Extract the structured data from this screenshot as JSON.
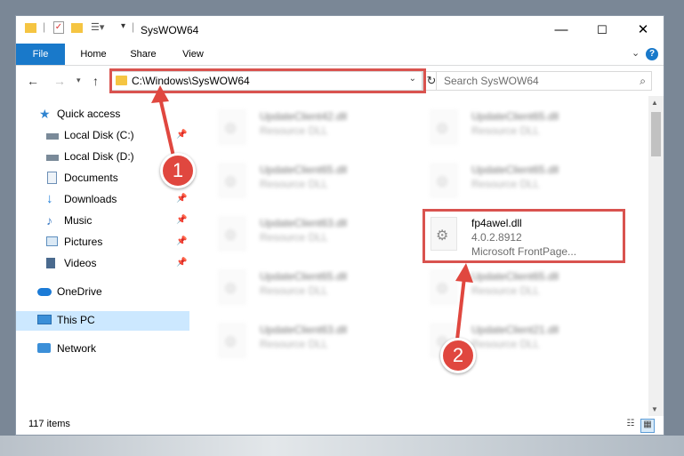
{
  "window": {
    "title": "SysWOW64",
    "controls": {
      "minimize": "—",
      "maximize": "☐",
      "close": "✕"
    }
  },
  "ribbon": {
    "tabs": [
      "File",
      "Home",
      "Share",
      "View"
    ],
    "help": "?"
  },
  "nav": {
    "address": "C:\\Windows\\SysWOW64",
    "search_placeholder": "Search SysWOW64"
  },
  "sidebar": {
    "items": [
      {
        "label": "Quick access",
        "icon": "star-icon",
        "color": "#2f84d0"
      },
      {
        "label": "Local Disk (C:)",
        "icon": "drive-icon",
        "color": "#7a8a99"
      },
      {
        "label": "Local Disk (D:)",
        "icon": "drive-icon",
        "color": "#7a8a99"
      },
      {
        "label": "Documents",
        "icon": "documents-icon",
        "color": "#6c8fb6"
      },
      {
        "label": "Downloads",
        "icon": "downloads-icon",
        "color": "#1f7fd9"
      },
      {
        "label": "Music",
        "icon": "music-icon",
        "color": "#3f7cc4"
      },
      {
        "label": "Pictures",
        "icon": "pictures-icon",
        "color": "#5e8fbf"
      },
      {
        "label": "Videos",
        "icon": "videos-icon",
        "color": "#4a6a8e"
      },
      {
        "label": "OneDrive",
        "icon": "onedrive-icon",
        "color": "#1c7bd6"
      },
      {
        "label": "This PC",
        "icon": "pc-icon",
        "color": "#3b8fd8"
      },
      {
        "label": "Network",
        "icon": "network-icon",
        "color": "#3b8fd8"
      }
    ]
  },
  "files": [
    {
      "name": "UpdateClient42.dll",
      "desc": "Resource DLL"
    },
    {
      "name": "UpdateClient65.dll",
      "desc": "Resource DLL"
    },
    {
      "name": "UpdateClient65.dll",
      "desc": "Resource DLL"
    },
    {
      "name": "UpdateClient65.dll",
      "desc": "Resource DLL"
    },
    {
      "name": "UpdateClient63.dll",
      "desc": "Resource DLL"
    },
    {
      "name": "fp4awel.dll",
      "version": "4.0.2.8912",
      "company": "Microsoft FrontPage..."
    },
    {
      "name": "UpdateClient65.dll",
      "desc": "Resource DLL"
    },
    {
      "name": "UpdateClient65.dll",
      "desc": "Resource DLL"
    },
    {
      "name": "UpdateClient63.dll",
      "desc": "Resource DLL"
    },
    {
      "name": "UpdateClient21.dll",
      "desc": "Resource DLL"
    }
  ],
  "status": {
    "item_count": "117 items"
  },
  "annotations": {
    "step1": "1",
    "step2": "2",
    "color": "#e0473f"
  }
}
